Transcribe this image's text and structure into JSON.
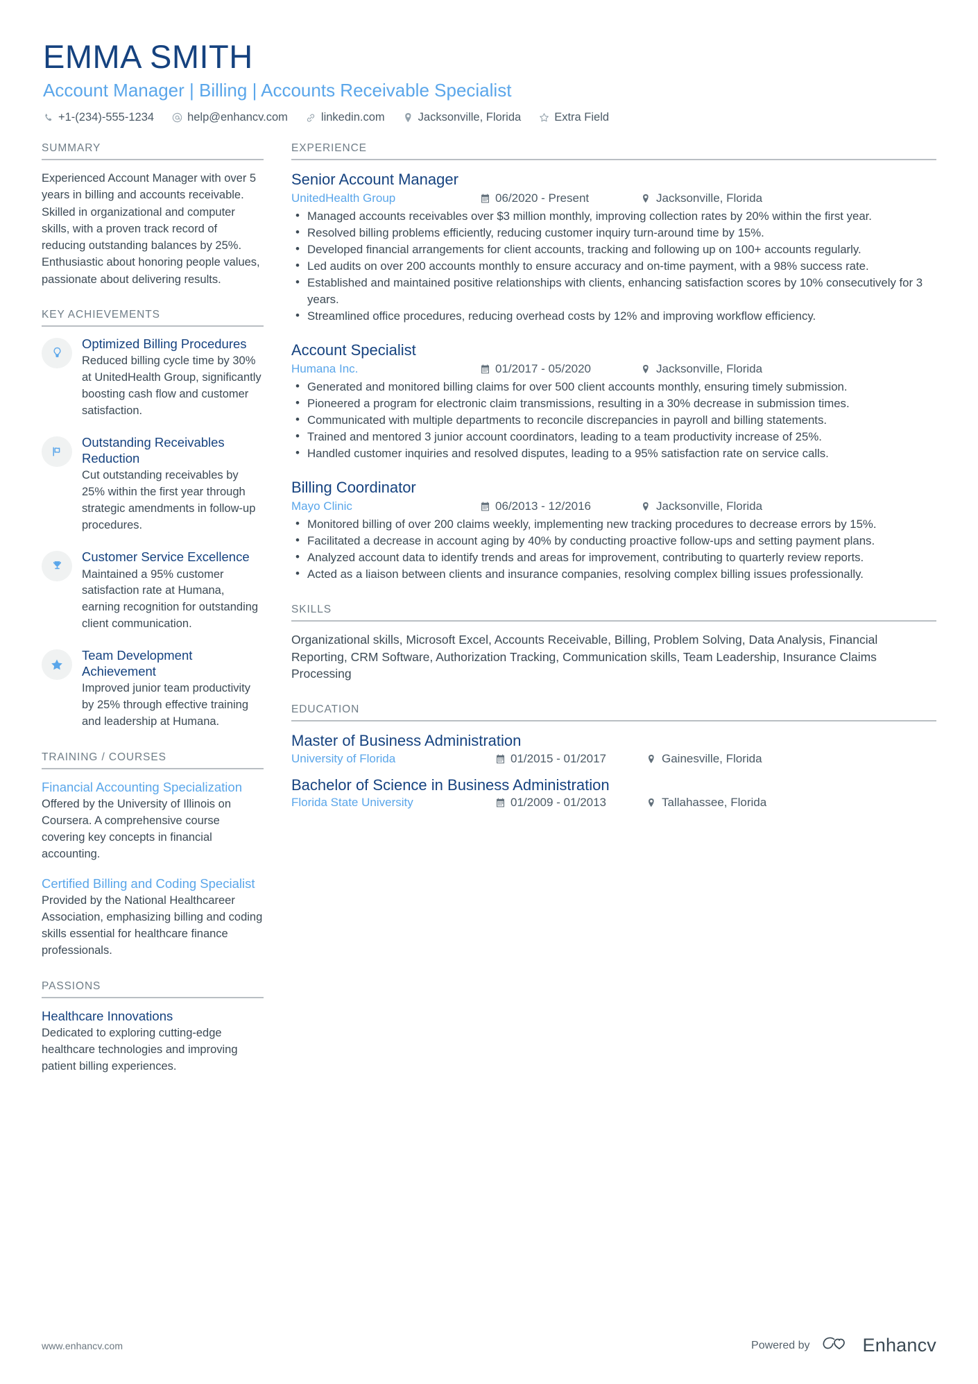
{
  "header": {
    "name": "EMMA SMITH",
    "title": "Account Manager | Billing | Accounts Receivable Specialist",
    "contacts": [
      {
        "icon": "phone-icon",
        "text": "+1-(234)-555-1234"
      },
      {
        "icon": "email-icon",
        "text": "help@enhancv.com"
      },
      {
        "icon": "link-icon",
        "text": "linkedin.com"
      },
      {
        "icon": "location-icon",
        "text": "Jacksonville, Florida"
      },
      {
        "icon": "star-icon",
        "text": "Extra Field"
      }
    ]
  },
  "colors": {
    "name_navy": "#15427f",
    "accent_blue": "#5aa6ea",
    "body_gray": "#3c4a55",
    "rule_gray": "#b9bec3",
    "icon_circle": "#f0f2f2"
  },
  "sidebar": {
    "summary": {
      "heading": "SUMMARY",
      "text": "Experienced Account Manager with over 5 years in billing and accounts receivable. Skilled in organizational and computer skills, with a proven track record of reducing outstanding balances by 25%. Enthusiastic about honoring people values, passionate about delivering results."
    },
    "achievements": {
      "heading": "KEY ACHIEVEMENTS",
      "items": [
        {
          "icon": "lightbulb-icon",
          "title": "Optimized Billing Procedures",
          "desc": "Reduced billing cycle time by 30% at UnitedHealth Group, significantly boosting cash flow and customer satisfaction."
        },
        {
          "icon": "flag-icon",
          "title": "Outstanding Receivables Reduction",
          "desc": "Cut outstanding receivables by 25% within the first year through strategic amendments in follow-up procedures."
        },
        {
          "icon": "trophy-icon",
          "title": "Customer Service Excellence",
          "desc": "Maintained a 95% customer satisfaction rate at Humana, earning recognition for outstanding client communication."
        },
        {
          "icon": "star-icon",
          "title": "Team Development Achievement",
          "desc": "Improved junior team productivity by 25% through effective training and leadership at Humana."
        }
      ]
    },
    "training": {
      "heading": "TRAINING / COURSES",
      "items": [
        {
          "title": "Financial Accounting Specialization",
          "desc": "Offered by the University of Illinois on Coursera. A comprehensive course covering key concepts in financial accounting."
        },
        {
          "title": "Certified Billing and Coding Specialist",
          "desc": "Provided by the National Healthcareer Association, emphasizing billing and coding skills essential for healthcare finance professionals."
        }
      ]
    },
    "passions": {
      "heading": "PASSIONS",
      "items": [
        {
          "title": "Healthcare Innovations",
          "desc": "Dedicated to exploring cutting-edge healthcare technologies and improving patient billing experiences."
        }
      ]
    }
  },
  "main": {
    "experience": {
      "heading": "EXPERIENCE",
      "jobs": [
        {
          "title": "Senior Account Manager",
          "company": "UnitedHealth Group",
          "date": "06/2020 - Present",
          "location": "Jacksonville, Florida",
          "bullets": [
            "Managed accounts receivables over $3 million monthly, improving collection rates by 20% within the first year.",
            "Resolved billing problems efficiently, reducing customer inquiry turn-around time by 15%.",
            "Developed financial arrangements for client accounts, tracking and following up on 100+ accounts regularly.",
            "Led audits on over 200 accounts monthly to ensure accuracy and on-time payment, with a 98% success rate.",
            "Established and maintained positive relationships with clients, enhancing satisfaction scores by 10% consecutively for 3 years.",
            "Streamlined office procedures, reducing overhead costs by 12% and improving workflow efficiency."
          ]
        },
        {
          "title": "Account Specialist",
          "company": "Humana Inc.",
          "date": "01/2017 - 05/2020",
          "location": "Jacksonville, Florida",
          "bullets": [
            "Generated and monitored billing claims for over 500 client accounts monthly, ensuring timely submission.",
            "Pioneered a program for electronic claim transmissions, resulting in a 30% decrease in submission times.",
            "Communicated with multiple departments to reconcile discrepancies in payroll and billing statements.",
            "Trained and mentored 3 junior account coordinators, leading to a team productivity increase of 25%.",
            "Handled customer inquiries and resolved disputes, leading to a 95% satisfaction rate on service calls."
          ]
        },
        {
          "title": "Billing Coordinator",
          "company": "Mayo Clinic",
          "date": "06/2013 - 12/2016",
          "location": "Jacksonville, Florida",
          "bullets": [
            "Monitored billing of over 200 claims weekly, implementing new tracking procedures to decrease errors by 15%.",
            "Facilitated a decrease in account aging by 40% by conducting proactive follow-ups and setting payment plans.",
            "Analyzed account data to identify trends and areas for improvement, contributing to quarterly review reports.",
            "Acted as a liaison between clients and insurance companies, resolving complex billing issues professionally."
          ]
        }
      ]
    },
    "skills": {
      "heading": "SKILLS",
      "text": "Organizational skills, Microsoft Excel, Accounts Receivable, Billing, Problem Solving, Data Analysis, Financial Reporting, CRM Software, Authorization Tracking, Communication skills, Team Leadership, Insurance Claims Processing"
    },
    "education": {
      "heading": "EDUCATION",
      "items": [
        {
          "degree": "Master of Business Administration",
          "school": "University of Florida",
          "date": "01/2015 - 01/2017",
          "location": "Gainesville, Florida"
        },
        {
          "degree": "Bachelor of Science in Business Administration",
          "school": "Florida State University",
          "date": "01/2009 - 01/2013",
          "location": "Tallahassee, Florida"
        }
      ]
    }
  },
  "footer": {
    "url": "www.enhancv.com",
    "powered_by": "Powered by",
    "brand": "Enhancv"
  }
}
